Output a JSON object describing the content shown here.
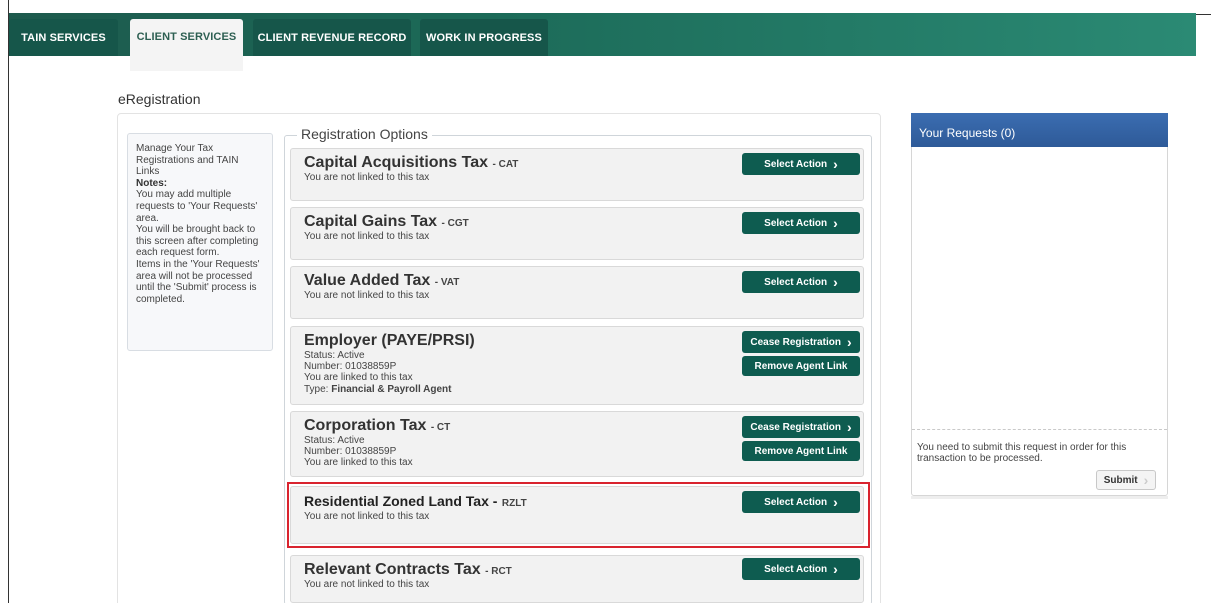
{
  "nav": {
    "tabs": [
      {
        "label": "TAIN SERVICES",
        "active": false
      },
      {
        "label": "CLIENT SERVICES",
        "active": true
      },
      {
        "label": "CLIENT REVENUE RECORD",
        "active": false
      },
      {
        "label": "WORK IN PROGRESS",
        "active": false
      }
    ]
  },
  "page": {
    "title": "eRegistration"
  },
  "help": {
    "intro": "Manage Your Tax Registrations and TAIN Links",
    "notes_label": "Notes:",
    "note1": "You may add multiple requests to 'Your Requests' area.",
    "note2": "You will be brought back to this screen after completing each request form.",
    "note3": "Items in the 'Your Requests' area will not be processed until the 'Submit' process is completed."
  },
  "options": {
    "legend": "Registration Options",
    "cat": {
      "name": "Capital Acquisitions Tax",
      "abbr": "- CAT",
      "status": "You are not linked to this tax",
      "button": "Select Action"
    },
    "cgt": {
      "name": "Capital Gains Tax",
      "abbr": "- CGT",
      "status": "You are not linked to this tax",
      "button": "Select Action"
    },
    "vat": {
      "name": "Value Added Tax",
      "abbr": "- VAT",
      "status": "You are not linked to this tax",
      "button": "Select Action"
    },
    "paye": {
      "name": "Employer (PAYE/PRSI)",
      "status": "Status: Active",
      "number": "Number: 01038859P",
      "linked": "You are linked to this tax",
      "type_label": "Type: ",
      "type_value": "Financial & Payroll Agent",
      "button1": "Cease Registration",
      "button2": "Remove Agent Link"
    },
    "ct": {
      "name": "Corporation Tax",
      "abbr": "- CT",
      "status": "Status: Active",
      "number": "Number: 01038859P",
      "linked": "You are linked to this tax",
      "button1": "Cease Registration",
      "button2": "Remove Agent Link"
    },
    "rzlt": {
      "name": "Residential Zoned Land Tax -",
      "abbr": "RZLT",
      "status": "You are not linked to this tax",
      "button": "Select Action"
    },
    "rct": {
      "name": "Relevant Contracts Tax",
      "abbr": "- RCT",
      "status": "You are not linked to this tax",
      "button": "Select Action"
    }
  },
  "requests": {
    "title": "Your Requests (0)",
    "note": "You need to submit this request in order for this transaction to be processed.",
    "submit": "Submit"
  }
}
